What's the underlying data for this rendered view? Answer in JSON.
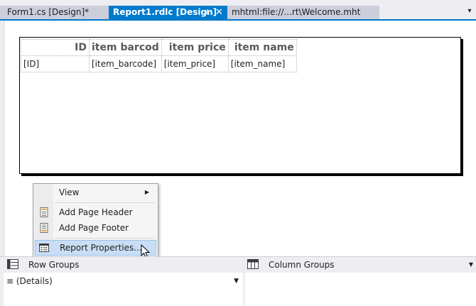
{
  "tabs": [
    {
      "label": "Form1.cs [Design]*",
      "active": false
    },
    {
      "label": "Report1.rdlc [Design]",
      "active": true
    },
    {
      "label": "mhtml:file://...rt\\Welcome.mht",
      "active": false
    }
  ],
  "tab_icons": {
    "pin": "pin-icon",
    "close": "close-icon",
    "dropdown": "chevron-down-icon"
  },
  "report": {
    "headers": [
      "ID",
      "item barcod",
      "item price",
      "item name"
    ],
    "row": [
      "[ID]",
      "[item_barcode]",
      "[item_price]",
      "[item_name]"
    ]
  },
  "context_menu": {
    "view": "View",
    "add_header": "Add Page Header",
    "add_footer": "Add Page Footer",
    "report_properties": "Report Properties..."
  },
  "grouping": {
    "row_groups": "Row Groups",
    "column_groups": "Column Groups",
    "details": "≡ (Details)"
  },
  "colors": {
    "accent": "#007acc",
    "menu_highlight": "#c9def5",
    "inactive_tab": "#cccedb"
  }
}
